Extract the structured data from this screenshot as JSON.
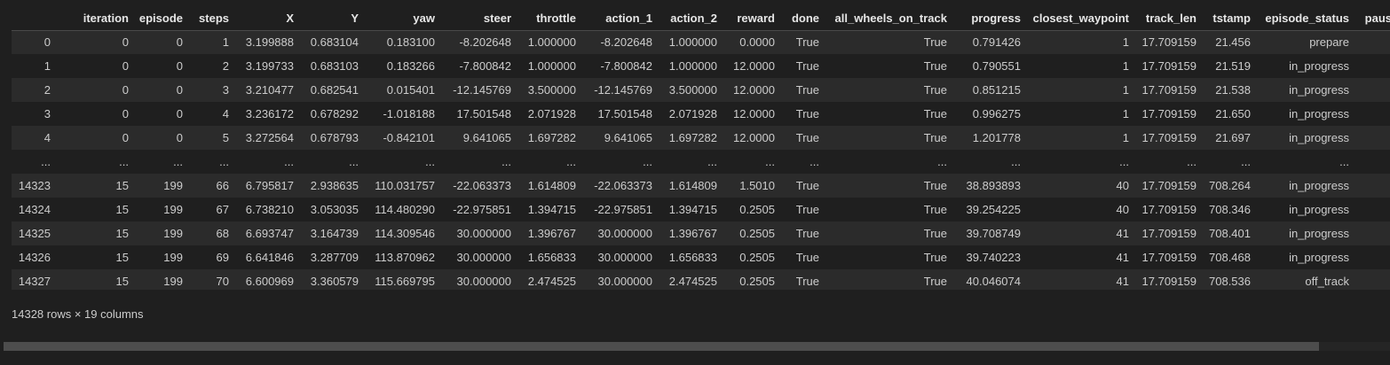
{
  "columns": [
    "",
    "iteration",
    "episode",
    "steps",
    "X",
    "Y",
    "yaw",
    "steer",
    "throttle",
    "action_1",
    "action_2",
    "reward",
    "done",
    "all_wheels_on_track",
    "progress",
    "closest_waypoint",
    "track_len",
    "tstamp",
    "episode_status",
    "paus"
  ],
  "rows": [
    [
      "0",
      "0",
      "0",
      "1",
      "3.199888",
      "0.683104",
      "0.183100",
      "-8.202648",
      "1.000000",
      "-8.202648",
      "1.000000",
      "0.0000",
      "True",
      "True",
      "0.791426",
      "1",
      "17.709159",
      "21.456",
      "prepare",
      ""
    ],
    [
      "1",
      "0",
      "0",
      "2",
      "3.199733",
      "0.683103",
      "0.183266",
      "-7.800842",
      "1.000000",
      "-7.800842",
      "1.000000",
      "12.0000",
      "True",
      "True",
      "0.790551",
      "1",
      "17.709159",
      "21.519",
      "in_progress",
      ""
    ],
    [
      "2",
      "0",
      "0",
      "3",
      "3.210477",
      "0.682541",
      "0.015401",
      "-12.145769",
      "3.500000",
      "-12.145769",
      "3.500000",
      "12.0000",
      "True",
      "True",
      "0.851215",
      "1",
      "17.709159",
      "21.538",
      "in_progress",
      ""
    ],
    [
      "3",
      "0",
      "0",
      "4",
      "3.236172",
      "0.678292",
      "-1.018188",
      "17.501548",
      "2.071928",
      "17.501548",
      "2.071928",
      "12.0000",
      "True",
      "True",
      "0.996275",
      "1",
      "17.709159",
      "21.650",
      "in_progress",
      ""
    ],
    [
      "4",
      "0",
      "0",
      "5",
      "3.272564",
      "0.678793",
      "-0.842101",
      "9.641065",
      "1.697282",
      "9.641065",
      "1.697282",
      "12.0000",
      "True",
      "True",
      "1.201778",
      "1",
      "17.709159",
      "21.697",
      "in_progress",
      ""
    ],
    [
      "...",
      "...",
      "...",
      "...",
      "...",
      "...",
      "...",
      "...",
      "...",
      "...",
      "...",
      "...",
      "...",
      "...",
      "...",
      "...",
      "...",
      "...",
      "...",
      ""
    ],
    [
      "14323",
      "15",
      "199",
      "66",
      "6.795817",
      "2.938635",
      "110.031757",
      "-22.063373",
      "1.614809",
      "-22.063373",
      "1.614809",
      "1.5010",
      "True",
      "True",
      "38.893893",
      "40",
      "17.709159",
      "708.264",
      "in_progress",
      ""
    ],
    [
      "14324",
      "15",
      "199",
      "67",
      "6.738210",
      "3.053035",
      "114.480290",
      "-22.975851",
      "1.394715",
      "-22.975851",
      "1.394715",
      "0.2505",
      "True",
      "True",
      "39.254225",
      "40",
      "17.709159",
      "708.346",
      "in_progress",
      ""
    ],
    [
      "14325",
      "15",
      "199",
      "68",
      "6.693747",
      "3.164739",
      "114.309546",
      "30.000000",
      "1.396767",
      "30.000000",
      "1.396767",
      "0.2505",
      "True",
      "True",
      "39.708749",
      "41",
      "17.709159",
      "708.401",
      "in_progress",
      ""
    ],
    [
      "14326",
      "15",
      "199",
      "69",
      "6.641846",
      "3.287709",
      "113.870962",
      "30.000000",
      "1.656833",
      "30.000000",
      "1.656833",
      "0.2505",
      "True",
      "True",
      "39.740223",
      "41",
      "17.709159",
      "708.468",
      "in_progress",
      ""
    ],
    [
      "14327",
      "15",
      "199",
      "70",
      "6.600969",
      "3.360579",
      "115.669795",
      "30.000000",
      "2.474525",
      "30.000000",
      "2.474525",
      "0.2505",
      "True",
      "True",
      "40.046074",
      "41",
      "17.709159",
      "708.536",
      "off_track",
      ""
    ]
  ],
  "shape_text": "14328 rows × 19 columns",
  "colors": {
    "background": "#1f1f1f",
    "row_alt": "#2b2b2b",
    "text": "#cccccc",
    "scrollbar_thumb": "#4d4d4d"
  }
}
